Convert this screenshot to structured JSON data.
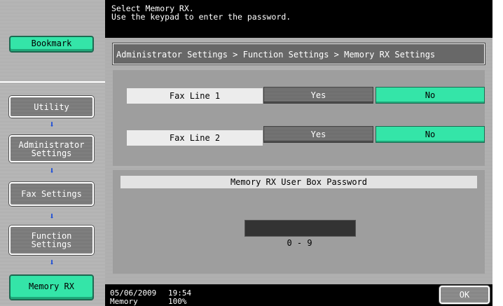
{
  "sidebar": {
    "bookmark_label": "Bookmark",
    "breadcrumb_items": [
      {
        "label": "Utility"
      },
      {
        "label": "Administrator\nSettings"
      },
      {
        "label": "Fax Settings"
      },
      {
        "label": "Function\nSettings"
      },
      {
        "label": "Memory RX"
      }
    ]
  },
  "message": {
    "line1": "Select Memory RX.",
    "line2": "Use the keypad to enter the password."
  },
  "path": "Administrator Settings > Function Settings > Memory RX Settings",
  "fax_lines": [
    {
      "label": "Fax Line 1",
      "yes": "Yes",
      "no": "No",
      "selected": "No"
    },
    {
      "label": "Fax Line 2",
      "yes": "Yes",
      "no": "No",
      "selected": "No"
    }
  ],
  "password": {
    "title": "Memory RX User Box Password",
    "value": "",
    "range": "0 - 9"
  },
  "footer": {
    "date": "05/06/2009",
    "time": "19:54",
    "memory_label": "Memory",
    "memory_value": "100%",
    "ok_label": "OK"
  },
  "colors": {
    "accent_green": "#34e5a8",
    "message_bg": "#000000"
  }
}
